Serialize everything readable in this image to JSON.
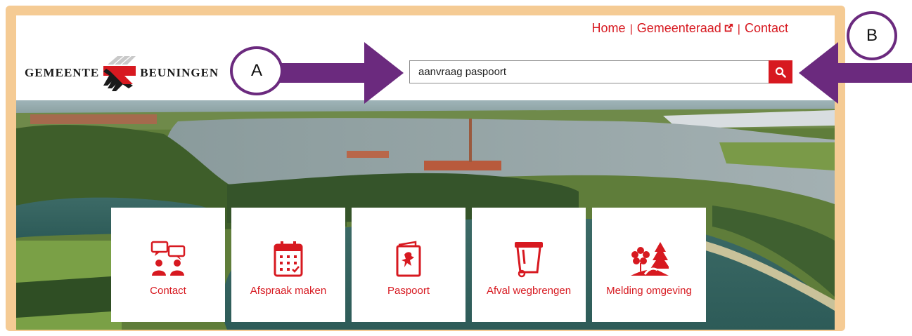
{
  "header": {
    "links": [
      {
        "label": "Home"
      },
      {
        "label": "Gemeenteraad",
        "external": true
      },
      {
        "label": "Contact"
      }
    ],
    "separator": "|",
    "logo_left": "GEMEENTE",
    "logo_right": "BEUNINGEN"
  },
  "search": {
    "value": "aanvraag paspoort",
    "button_icon": "search-icon"
  },
  "tiles": [
    {
      "label": "Contact",
      "icon": "chat-people-icon"
    },
    {
      "label": "Afspraak maken",
      "icon": "calendar-icon"
    },
    {
      "label": "Paspoort",
      "icon": "passport-icon"
    },
    {
      "label": "Afval wegbrengen",
      "icon": "waste-bin-icon"
    },
    {
      "label": "Melding omgeving",
      "icon": "nature-icon"
    }
  ],
  "annotations": {
    "a_label": "A",
    "b_label": "B"
  },
  "colors": {
    "brand_red": "#d71920",
    "frame": "#f5cb94",
    "annotation_purple": "#6b2a7e"
  }
}
